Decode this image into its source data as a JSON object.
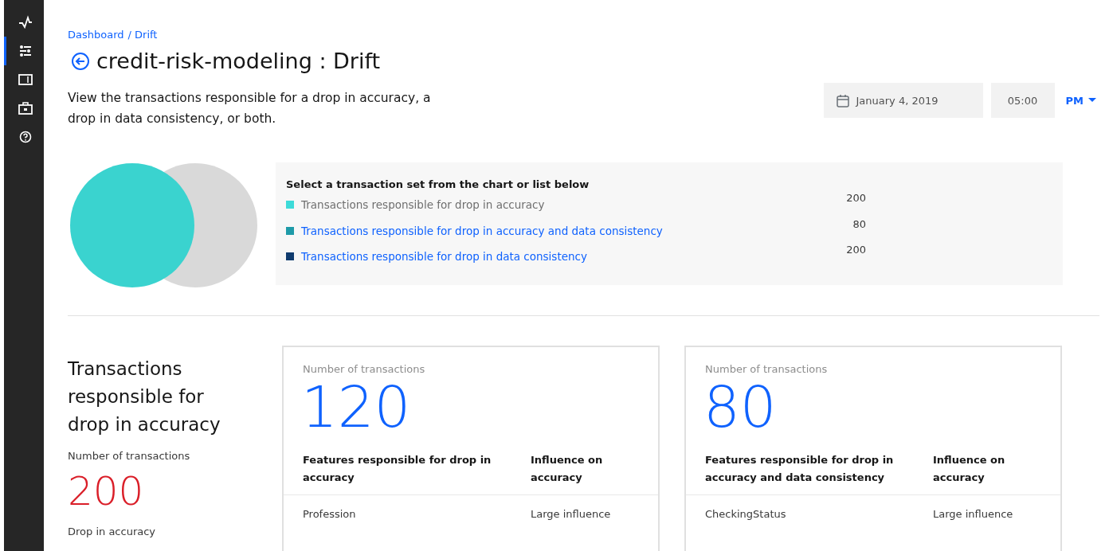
{
  "sidebar": {
    "items": [
      {
        "selected": false
      },
      {
        "selected": true
      },
      {
        "selected": false
      },
      {
        "selected": false
      },
      {
        "selected": false
      }
    ]
  },
  "breadcrumb": [
    {
      "label": "Dashboard"
    },
    {
      "label": "/ Drift"
    }
  ],
  "title": "credit-risk-modeling : Drift",
  "description": "View the transactions responsible for a drop in accuracy, a drop in data consistency, or both.",
  "date_field": {
    "value": "January 4, 2019"
  },
  "time_field": {
    "value": "05:00"
  },
  "period_select": {
    "value": "PM"
  },
  "legend": {
    "heading": "Select a transaction set from the chart or list below",
    "items": [
      {
        "label": "Transactions responsible for drop in accuracy",
        "value": "200",
        "color": "#3ddbd9",
        "selected": true
      },
      {
        "label": "Transactions responsible for drop in accuracy and data consistency",
        "value": "80",
        "color": "#1e9aa8",
        "selected": false
      },
      {
        "label": "Transactions responsible for drop in data consistency",
        "value": "200",
        "color": "#0f3b6e",
        "selected": false
      }
    ]
  },
  "summary": {
    "heading": "Transactions responsible for drop in accuracy",
    "count_label": "Number of transactions",
    "count": "200",
    "drop_label": "Drop in accuracy"
  },
  "cards": [
    {
      "count_label": "Number of transactions",
      "count": "120",
      "columns": [
        "Features responsible for drop in accuracy",
        "Influence on accuracy"
      ],
      "rows": [
        [
          "Profession",
          "Large influence"
        ]
      ]
    },
    {
      "count_label": "Number of transactions",
      "count": "80",
      "columns": [
        "Features responsible for drop in accuracy and data consistency",
        "Influence on accuracy"
      ],
      "rows": [
        [
          "CheckingStatus",
          "Large influence"
        ]
      ]
    }
  ]
}
